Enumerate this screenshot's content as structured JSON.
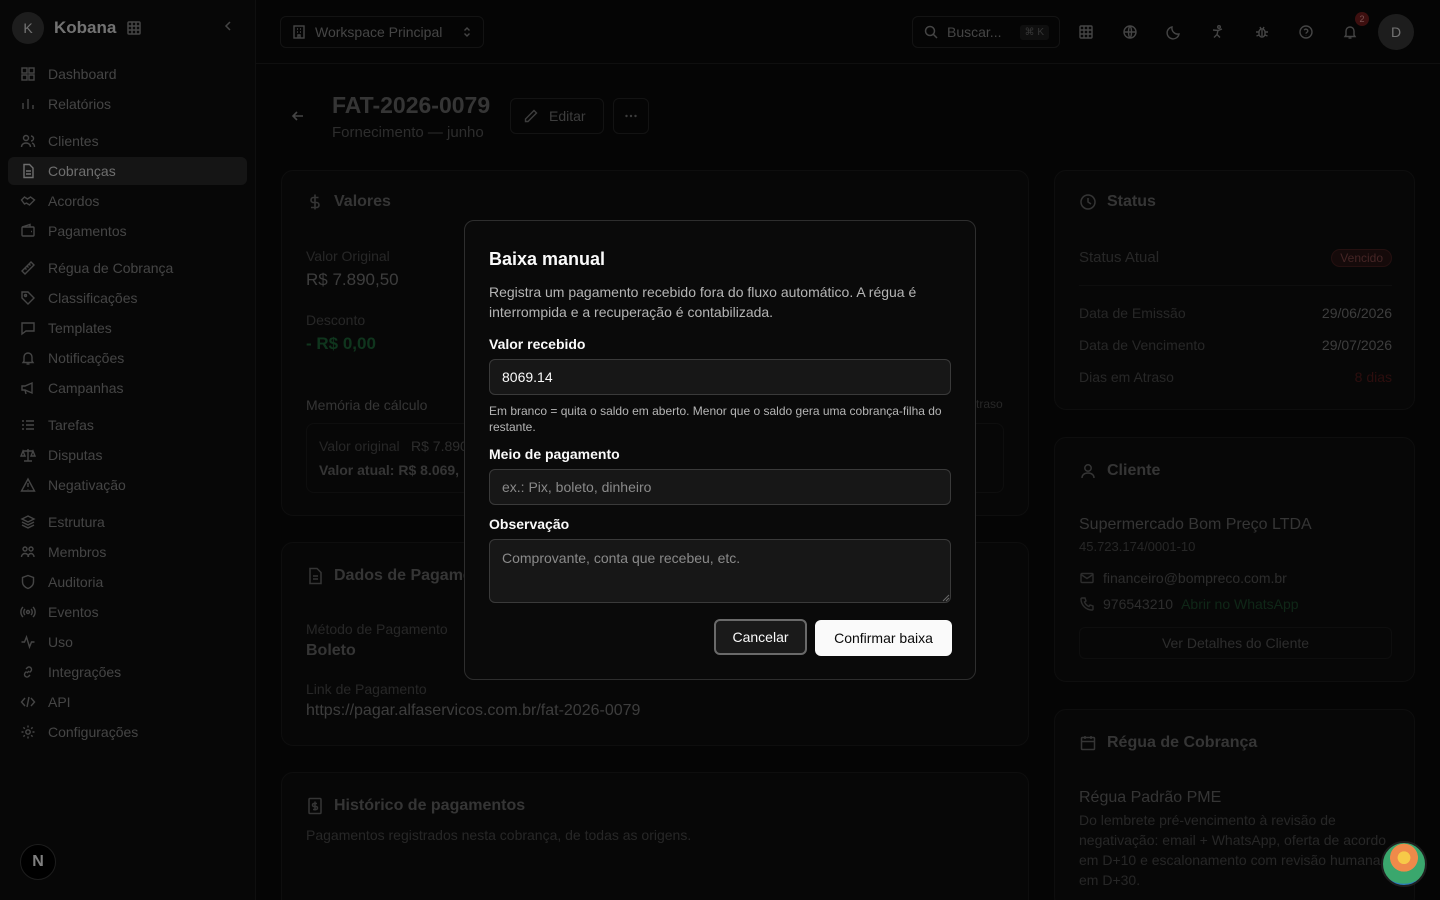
{
  "sidebar": {
    "avatar_letter": "K",
    "brand": "Kobana",
    "items": [
      {
        "label": "Dashboard",
        "icon": "grid-icon"
      },
      {
        "label": "Relatórios",
        "icon": "chart-icon"
      },
      {
        "label": "Clientes",
        "icon": "users-icon"
      },
      {
        "label": "Cobranças",
        "icon": "file-icon",
        "active": true
      },
      {
        "label": "Acordos",
        "icon": "handshake-icon"
      },
      {
        "label": "Pagamentos",
        "icon": "wallet-icon"
      },
      {
        "label": "Régua de Cobrança",
        "icon": "ruler-icon"
      },
      {
        "label": "Classificações",
        "icon": "tag-icon"
      },
      {
        "label": "Templates",
        "icon": "message-icon"
      },
      {
        "label": "Notificações",
        "icon": "bell-icon"
      },
      {
        "label": "Campanhas",
        "icon": "megaphone-icon"
      },
      {
        "label": "Tarefas",
        "icon": "list-icon"
      },
      {
        "label": "Disputas",
        "icon": "scale-icon"
      },
      {
        "label": "Negativação",
        "icon": "alert-icon"
      },
      {
        "label": "Estrutura",
        "icon": "layers-icon"
      },
      {
        "label": "Membros",
        "icon": "members-icon"
      },
      {
        "label": "Auditoria",
        "icon": "shield-icon"
      },
      {
        "label": "Eventos",
        "icon": "radio-icon"
      },
      {
        "label": "Uso",
        "icon": "activity-icon"
      },
      {
        "label": "Integrações",
        "icon": "link-icon"
      },
      {
        "label": "API",
        "icon": "code-icon"
      },
      {
        "label": "Configurações",
        "icon": "gear-icon"
      }
    ],
    "next_badge": "N"
  },
  "topbar": {
    "workspace": "Workspace Principal",
    "search_placeholder": "Buscar...",
    "search_shortcut": "⌘ K",
    "notification_count": "2",
    "user_letter": "D"
  },
  "page": {
    "title": "FAT-2026-0079",
    "subtitle": "Fornecimento — junho",
    "edit_label": "Editar"
  },
  "valores": {
    "title": "Valores",
    "valor_original_label": "Valor Original",
    "valor_original": "R$ 7.890,50",
    "desconto_label": "Desconto",
    "desconto": "- R$ 0,00",
    "memoria_label": "Memória de cálculo",
    "memoria_line1_label": "Valor original",
    "memoria_line1_value": "R$ 7.890",
    "memoria_line2": "Valor atual: R$ 8.069,",
    "atraso_fragment": "traso"
  },
  "dados_pagamento": {
    "title": "Dados de Pagame",
    "metodo_label": "Método de Pagamento",
    "metodo": "Boleto",
    "link_label": "Link de Pagamento",
    "link": "https://pagar.alfaservicos.com.br/fat-2026-0079"
  },
  "historico": {
    "title": "Histórico de pagamentos",
    "subtitle": "Pagamentos registrados nesta cobrança, de todas as origens."
  },
  "status": {
    "title": "Status",
    "atual_label": "Status Atual",
    "atual_badge": "Vencido",
    "emissao_label": "Data de Emissão",
    "emissao": "29/06/2026",
    "vencimento_label": "Data de Vencimento",
    "vencimento": "29/07/2026",
    "atraso_label": "Dias em Atraso",
    "atraso": "8 dias"
  },
  "cliente": {
    "title": "Cliente",
    "name": "Supermercado Bom Preço LTDA",
    "doc": "45.723.174/0001-10",
    "email": "financeiro@bompreco.com.br",
    "phone": "976543210",
    "whatsapp": "Abrir no WhatsApp",
    "details_button": "Ver Detalhes do Cliente"
  },
  "regua": {
    "title": "Régua de Cobrança",
    "name": "Régua Padrão PME",
    "description": "Do lembrete pré-vencimento à revisão de negativação: email + WhatsApp, oferta de acordo em D+10 e escalonamento com revisão humana em D+30."
  },
  "modal": {
    "title": "Baixa manual",
    "description": "Registra um pagamento recebido fora do fluxo automático. A régua é interrompida e a recuperação é contabilizada.",
    "valor_label": "Valor recebido",
    "valor_value": "8069.14",
    "valor_help": "Em branco = quita o saldo em aberto. Menor que o saldo gera uma cobrança-filha do restante.",
    "meio_label": "Meio de pagamento",
    "meio_placeholder": "ex.: Pix, boleto, dinheiro",
    "obs_label": "Observação",
    "obs_placeholder": "Comprovante, conta que recebeu, etc.",
    "cancel_label": "Cancelar",
    "confirm_label": "Confirmar baixa"
  },
  "colors": {
    "background": "#0a0a0a",
    "accent_green": "#1f6b3a",
    "danger": "#7a1f1f"
  }
}
